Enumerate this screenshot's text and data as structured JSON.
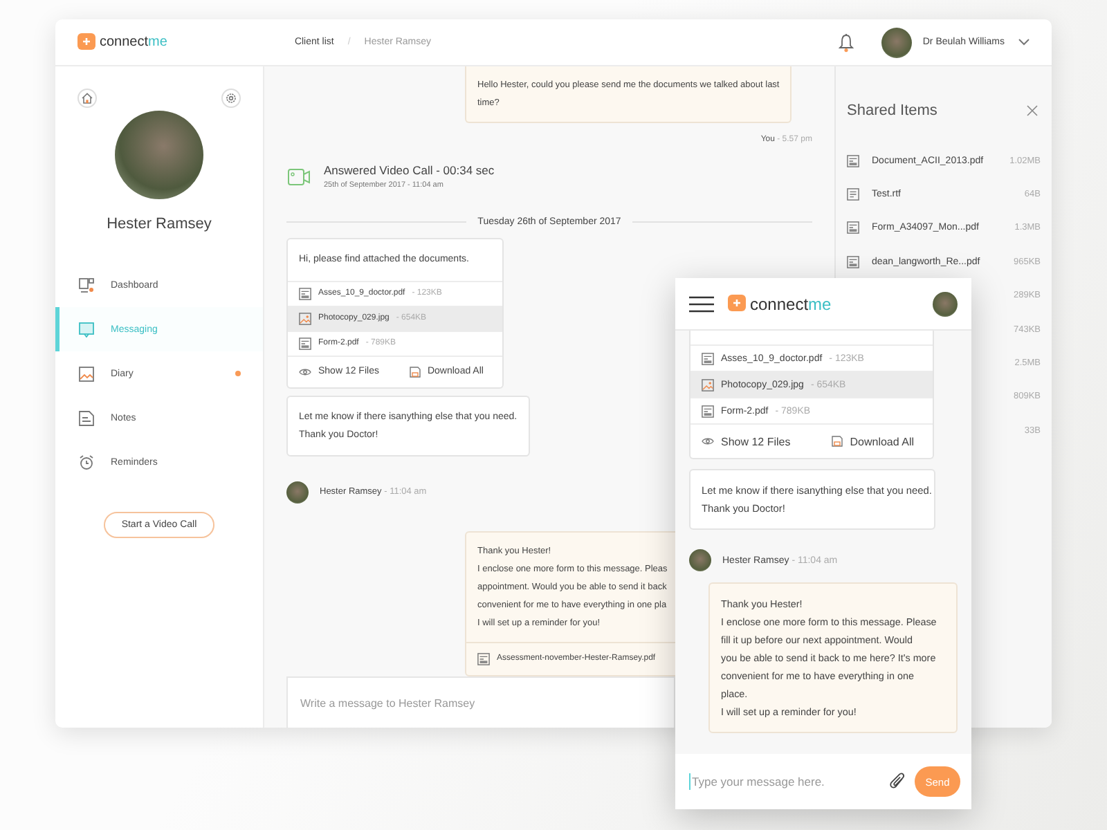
{
  "desktop": {
    "logo": {
      "first": "connect",
      "second": "me"
    },
    "breadcrumb": {
      "items": [
        "Client list",
        "Hester Ramsey"
      ],
      "separator": "/"
    },
    "user": {
      "name": "Dr Beulah Williams"
    },
    "sidebar": {
      "name": "Hester Ramsey",
      "nav": [
        {
          "label": "Dashboard",
          "kind": "dashboard",
          "selected": false,
          "dot": false
        },
        {
          "label": "Messaging",
          "kind": "messaging",
          "selected": true,
          "dot": false
        },
        {
          "label": "Diary",
          "kind": "diary",
          "selected": false,
          "dot": true
        },
        {
          "label": "Notes",
          "kind": "notes",
          "selected": false,
          "dot": false
        },
        {
          "label": "Reminders",
          "kind": "reminders",
          "selected": false,
          "dot": false
        }
      ],
      "call_button": "Start a Video Call"
    },
    "chat": {
      "items": [
        {
          "kind": "outgoing",
          "lines": [
            "Hello Hester, could you please send me the documents we talked about last",
            "time?"
          ]
        },
        {
          "kind": "stamp",
          "author": "You",
          "time": "- 5.57 pm"
        },
        {
          "kind": "call",
          "title": "Answered Video Call - 00:34 sec",
          "subtitle": "25th of September 2017 - 11:04 am"
        },
        {
          "kind": "divider",
          "text": "Tuesday 26th of September 2017"
        },
        {
          "kind": "attachments",
          "text": "Hi, please find attached the documents.",
          "files": [
            {
              "name": "Asses_10_9_doctor.pdf",
              "size": "- 123KB",
              "kind": "pdf",
              "highlighted": false
            },
            {
              "name": "Photocopy_029.jpg",
              "size": "- 654KB",
              "kind": "image",
              "highlighted": true
            },
            {
              "name": "Form-2.pdf",
              "size": "- 789KB",
              "kind": "pdf",
              "highlighted": false
            }
          ],
          "show": "Show 12 Files",
          "download": "Download All"
        },
        {
          "kind": "incoming",
          "lines": [
            "Let me know if there isanything else that you need.",
            "Thank you Doctor!"
          ]
        },
        {
          "kind": "sender",
          "author": "Hester Ramsey",
          "time": "- 11:04 am"
        },
        {
          "kind": "outgoing",
          "lines": [
            "Thank you Hester!",
            "I enclose one more form to this message. Pleas",
            "appointment. Would you be able to send it back",
            "convenient for me to have everything in one pla",
            "I will set up a reminder for you!"
          ],
          "file": "Assessment-november-Hester-Ramsey.pdf"
        }
      ],
      "composer": {
        "placeholder": "Write a message to Hester Ramsey"
      }
    },
    "shared": {
      "title": "Shared Items",
      "items": [
        {
          "name": "Document_ACII_2013.pdf",
          "kind": "pdf",
          "size": "1.02MB"
        },
        {
          "name": "Test.rtf",
          "kind": "text",
          "size": "64B"
        },
        {
          "name": "Form_A34097_Mon...pdf",
          "kind": "pdf",
          "size": "1.3MB"
        },
        {
          "name": "dean_langworth_Re...pdf",
          "kind": "pdf",
          "size": "965KB"
        },
        {
          "size": "289KB"
        },
        {
          "size": "743KB"
        },
        {
          "size": "2.5MB"
        },
        {
          "size": "809KB"
        },
        {
          "size": "33B"
        }
      ]
    }
  },
  "mobile": {
    "logo": {
      "first": "connect",
      "second": "me"
    },
    "items": [
      {
        "kind": "attachments",
        "files": [
          {
            "name": "Asses_10_9_doctor.pdf",
            "size": "- 123KB",
            "kind": "pdf",
            "highlighted": false
          },
          {
            "name": "Photocopy_029.jpg",
            "size": "- 654KB",
            "kind": "image",
            "highlighted": true
          },
          {
            "name": "Form-2.pdf",
            "size": "- 789KB",
            "kind": "pdf",
            "highlighted": false
          }
        ],
        "show": "Show 12 Files",
        "download": "Download All"
      },
      {
        "kind": "incoming",
        "lines": [
          "Let me know if there isanything else that you need.",
          "Thank you Doctor!"
        ]
      },
      {
        "kind": "sender",
        "author": "Hester Ramsey",
        "time": "- 11:04 am"
      },
      {
        "kind": "outgoing",
        "lines": [
          "Thank you Hester!",
          "I enclose one more form to this message. Please",
          "fill it up before our next appointment. Would",
          "you be able to send it back to me here? It's more",
          "convenient for me to have everything in one",
          "place.",
          "I will set up a reminder for you!"
        ]
      }
    ],
    "composer": {
      "placeholder": "Type your message here.",
      "send": "Send"
    }
  }
}
